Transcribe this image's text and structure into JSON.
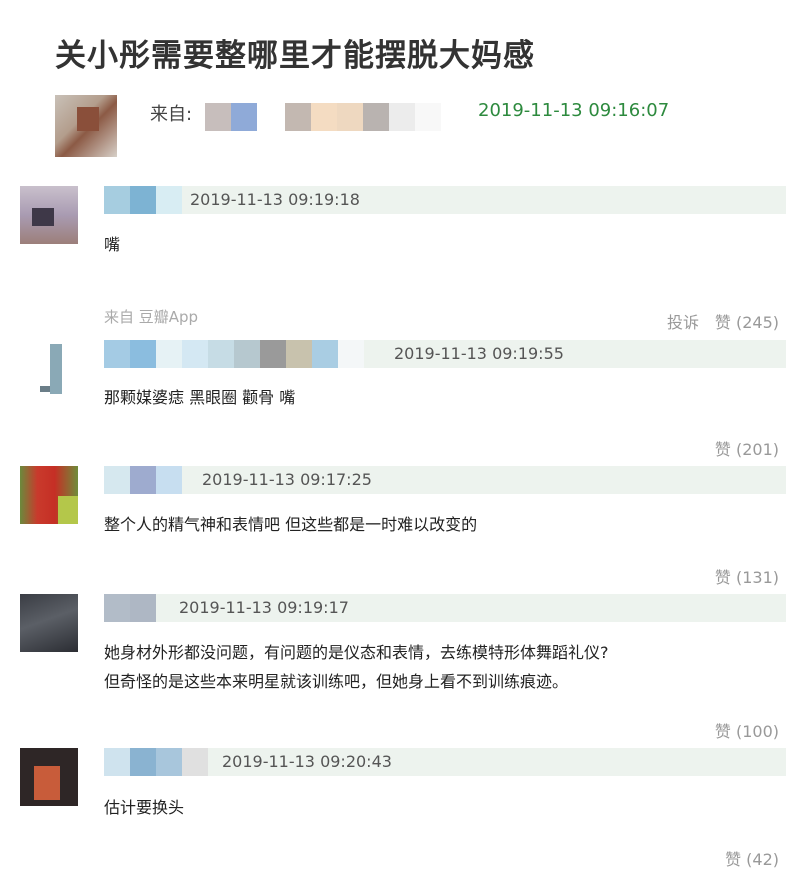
{
  "post": {
    "title": "关小彤需要整哪里才能摆脱大妈感",
    "from_label": "来自:",
    "time": "2019-11-13 09:16:07"
  },
  "comments": [
    {
      "time": "2019-11-13 09:19:18",
      "text": "嘴",
      "source": "来自 豆瓣App",
      "report": "投诉",
      "likes": "赞 (245)"
    },
    {
      "time": "2019-11-13 09:19:55",
      "text": "那颗媒婆痣 黑眼圈 颧骨 嘴",
      "likes": "赞 (201)"
    },
    {
      "time": "2019-11-13 09:17:25",
      "text": "整个人的精气神和表情吧 但这些都是一时难以改变的",
      "likes": "赞 (131)"
    },
    {
      "time": "2019-11-13 09:19:17",
      "text_line1": "她身材外形都没问题，有问题的是仪态和表情，去练模特形体舞蹈礼仪?",
      "text_line2": "但奇怪的是这些本来明星就该训练吧，但她身上看不到训练痕迹。",
      "likes": "赞 (100)"
    },
    {
      "time": "2019-11-13 09:20:43",
      "text": "估计要换头",
      "likes": "赞 (42)"
    }
  ]
}
